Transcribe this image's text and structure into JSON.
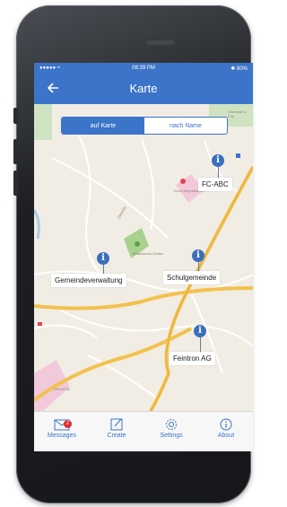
{
  "status_bar": {
    "signal": "●●●●● ≈",
    "time": "08:39 PM",
    "battery": "✱ 80%"
  },
  "header": {
    "title": "Karte",
    "back_icon": "back-arrow-icon"
  },
  "segment": {
    "active_label": "auf Karte",
    "inactive_label": "nach Name"
  },
  "map_labels": {
    "corner": "Obermatt & Frie",
    "church": "Kirch Stephanshorn",
    "garden": "Botanischer Garten",
    "street": "Zilstraße",
    "area": "KRONTAL"
  },
  "pins": [
    {
      "name": "FC-ABC"
    },
    {
      "name": "Gemeindeverwaltung"
    },
    {
      "name": "Schulgemeinde"
    },
    {
      "name": "Feintron AG"
    }
  ],
  "tabs": [
    {
      "label": "Messages",
      "icon": "envelope-icon",
      "badge": "2"
    },
    {
      "label": "Create",
      "icon": "edit-icon"
    },
    {
      "label": "Settings",
      "icon": "gear-icon"
    },
    {
      "label": "About",
      "icon": "info-icon"
    }
  ],
  "colors": {
    "accent": "#3b74c9",
    "badge": "#e02a2a",
    "road": "#f2c14e"
  }
}
